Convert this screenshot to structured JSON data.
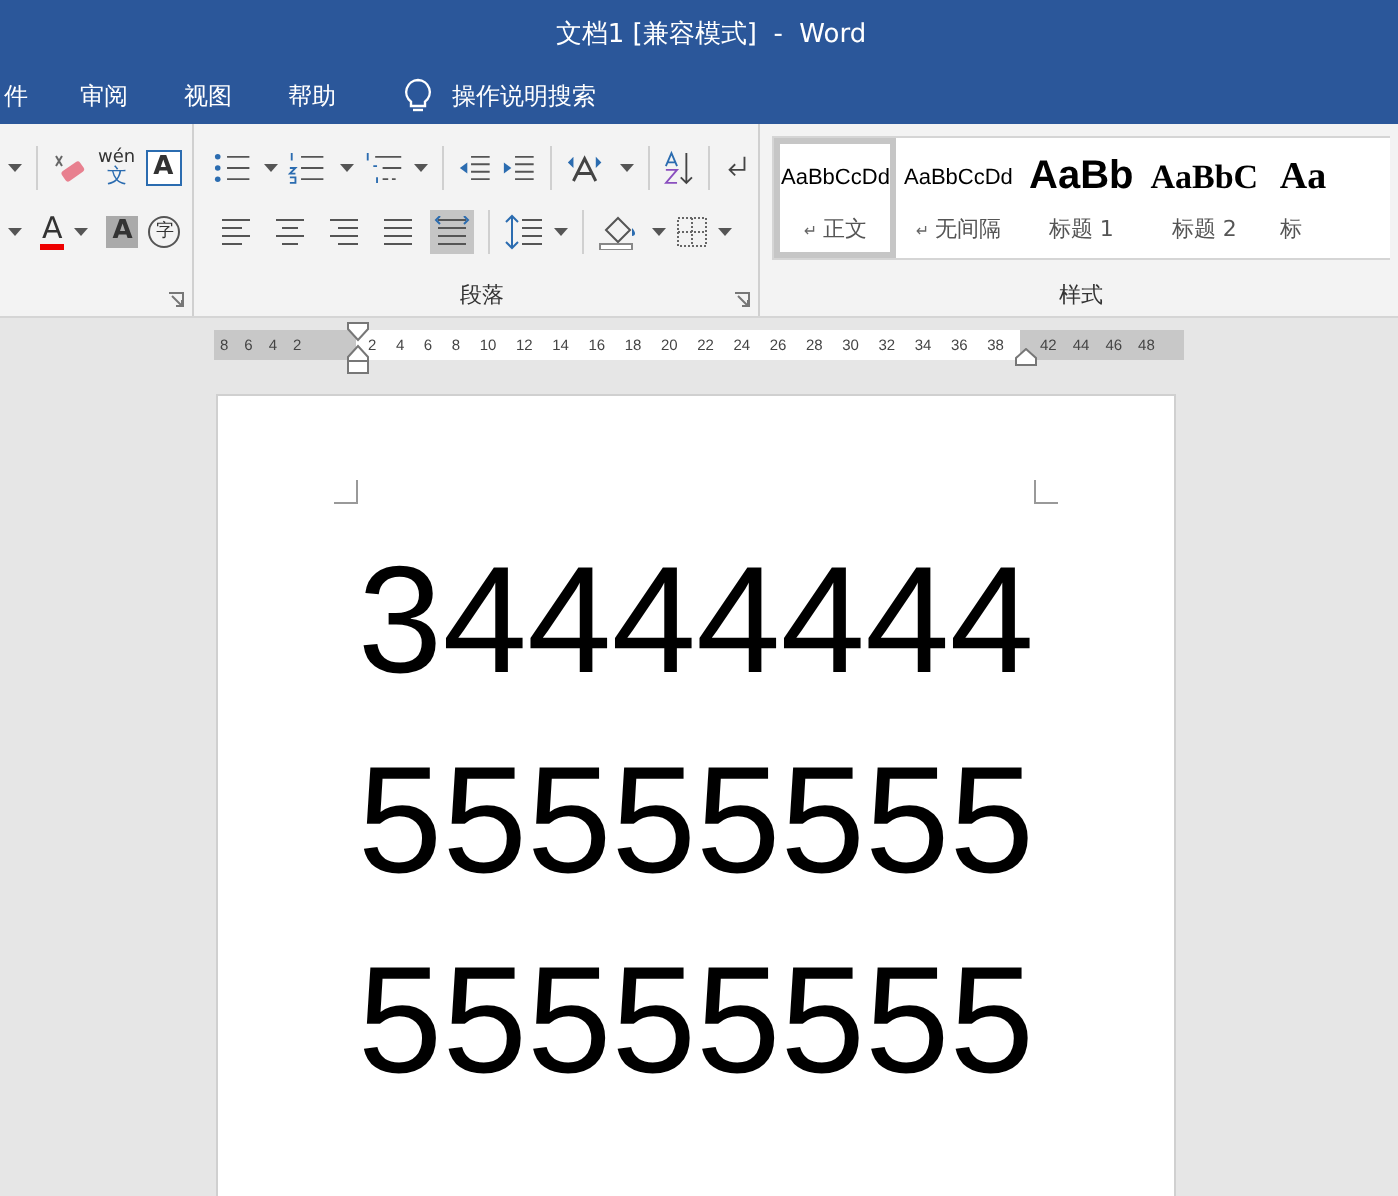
{
  "window": {
    "title": "文档1 [兼容模式]  -  Word"
  },
  "menu": {
    "tabs": [
      {
        "label": "件",
        "selected": false
      },
      {
        "label": "审阅",
        "selected": false
      },
      {
        "label": "视图",
        "selected": false
      },
      {
        "label": "帮助",
        "selected": false
      }
    ],
    "search": "操作说明搜索"
  },
  "font_group": {
    "phonetic_top": "wén",
    "phonetic_bottom": "文",
    "border_char": "A",
    "color_char": "A",
    "shading_char": "A",
    "enclosed_char": "字"
  },
  "paragraph_group": {
    "label": "段落",
    "alignment": [
      {
        "kind": "left",
        "selected": false
      },
      {
        "kind": "center",
        "selected": false
      },
      {
        "kind": "right",
        "selected": false
      },
      {
        "kind": "justify",
        "selected": false
      },
      {
        "kind": "distributed",
        "selected": true
      }
    ]
  },
  "styles_group": {
    "label": "样式",
    "styles": [
      {
        "kind": "normal",
        "preview": "AaBbCcDd",
        "mark": "↵",
        "name": "正文",
        "selected": true
      },
      {
        "kind": "normal",
        "preview": "AaBbCcDd",
        "mark": "↵",
        "name": "无间隔",
        "selected": false
      },
      {
        "kind": "heading1",
        "preview": "AaBb",
        "name": "标题 1",
        "selected": false
      },
      {
        "kind": "heading2",
        "preview": "AaBbC",
        "name": "标题 2",
        "selected": false
      },
      {
        "kind": "title",
        "preview": "Aa",
        "name": "标",
        "selected": false
      }
    ]
  },
  "ruler": {
    "left_ticks": [
      "8",
      "6",
      "4",
      "2"
    ],
    "ticks": [
      "2",
      "4",
      "6",
      "8",
      "10",
      "12",
      "14",
      "16",
      "18",
      "20",
      "22",
      "24",
      "26",
      "28",
      "30",
      "32",
      "34",
      "36",
      "38"
    ],
    "right_ticks": [
      "42",
      "44",
      "46",
      "48"
    ]
  },
  "document": {
    "lines": [
      "34444444",
      "55555555",
      "55555555"
    ]
  }
}
